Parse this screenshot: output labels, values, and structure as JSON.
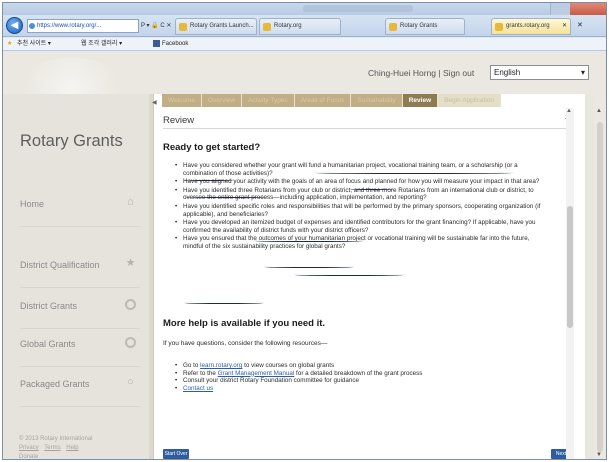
{
  "browser": {
    "address": "https://www.rotary.org/...",
    "address_tools": "P ▾ 🔒 C ✕",
    "tabs": [
      {
        "label": "Rotary Grants Launch...",
        "active": false
      },
      {
        "label": "Rotary.org",
        "active": false
      },
      {
        "label": "Rotary Grants",
        "active": true
      },
      {
        "label": "grants.rotary.org",
        "active": false
      }
    ],
    "favorites": [
      "추천 사이트 ▾",
      "웹 조각 갤러리 ▾",
      "Facebook"
    ]
  },
  "site": {
    "user_name": "Ching-Huei Horng",
    "separator": "|",
    "sign_out": "Sign out",
    "language": "English",
    "brand": "Rotary Grants"
  },
  "sidebar": {
    "items": [
      {
        "label": "Home",
        "icon": "home-icon",
        "glyph": "⌂"
      },
      {
        "label": "District Qualification",
        "icon": "star-icon",
        "glyph": "★"
      },
      {
        "label": "District Grants",
        "icon": "ring-icon",
        "glyph": ""
      },
      {
        "label": "Global Grants",
        "icon": "globe-icon",
        "glyph": ""
      },
      {
        "label": "Packaged Grants",
        "icon": "circle-arrow-icon",
        "glyph": "○"
      }
    ],
    "footer": {
      "copyright": "© 2013 Rotary International",
      "links": [
        "Privacy",
        "Terms",
        "Help"
      ],
      "extra": "Donate"
    }
  },
  "stepper": {
    "steps": [
      {
        "label": "Welcome",
        "state": "done"
      },
      {
        "label": "Overview",
        "state": "done"
      },
      {
        "label": "Activity Types",
        "state": "done"
      },
      {
        "label": "Areas of Focus",
        "state": "done"
      },
      {
        "label": "Sustainability",
        "state": "done"
      },
      {
        "label": "Review",
        "state": "active"
      },
      {
        "label": "Begin Application",
        "state": "disabled"
      }
    ]
  },
  "review": {
    "title": "Review",
    "heading_ready": "Ready to get started?",
    "questions": [
      "Have you considered whether your grant will fund a humanitarian project, vocational training team, or a scholarship (or a combination of those activities)?",
      "Have you aligned your activity with the goals of an area of focus and planned for how you will measure your impact in that area?",
      "Have you identified three Rotarians from your club or district, and three more Rotarians from an international club or district, to oversee the entire grant process—including application, implementation, and reporting?",
      "Have you identified specific roles and responsibilities that will be performed by the primary sponsors, cooperating organization (if applicable), and beneficiaries?",
      "Have you developed an itemized budget of expenses and identified contributors for the grant financing? If applicable, have you confirmed the availability of district funds with your district officers?",
      "Have you ensured that the outcomes of your humanitarian project or vocational training will be sustainable far into the future, mindful of the six sustainability practices for global grants?"
    ],
    "heading_more": "More help is available if you need it.",
    "intro": "If you have questions, consider the following resources—",
    "resources": [
      {
        "pre": "Go to ",
        "link": "learn.rotary.org",
        "post": " to view courses on global grants"
      },
      {
        "pre": "Refer to the ",
        "link": "Grant Management Manual",
        "post": " for a detailed breakdown of the grant process"
      },
      {
        "pre": "Consult your district Rotary Foundation committee for guidance",
        "link": "",
        "post": ""
      },
      {
        "pre": "Contact us",
        "link": "",
        "post": ""
      }
    ],
    "start_button": "Start Over",
    "next_button": "Next"
  },
  "colors": {
    "step_active": "#8d7b52",
    "step_done": "#bfae86",
    "button_blue": "#2e5d9f",
    "page_bg": "#e9e6de"
  }
}
